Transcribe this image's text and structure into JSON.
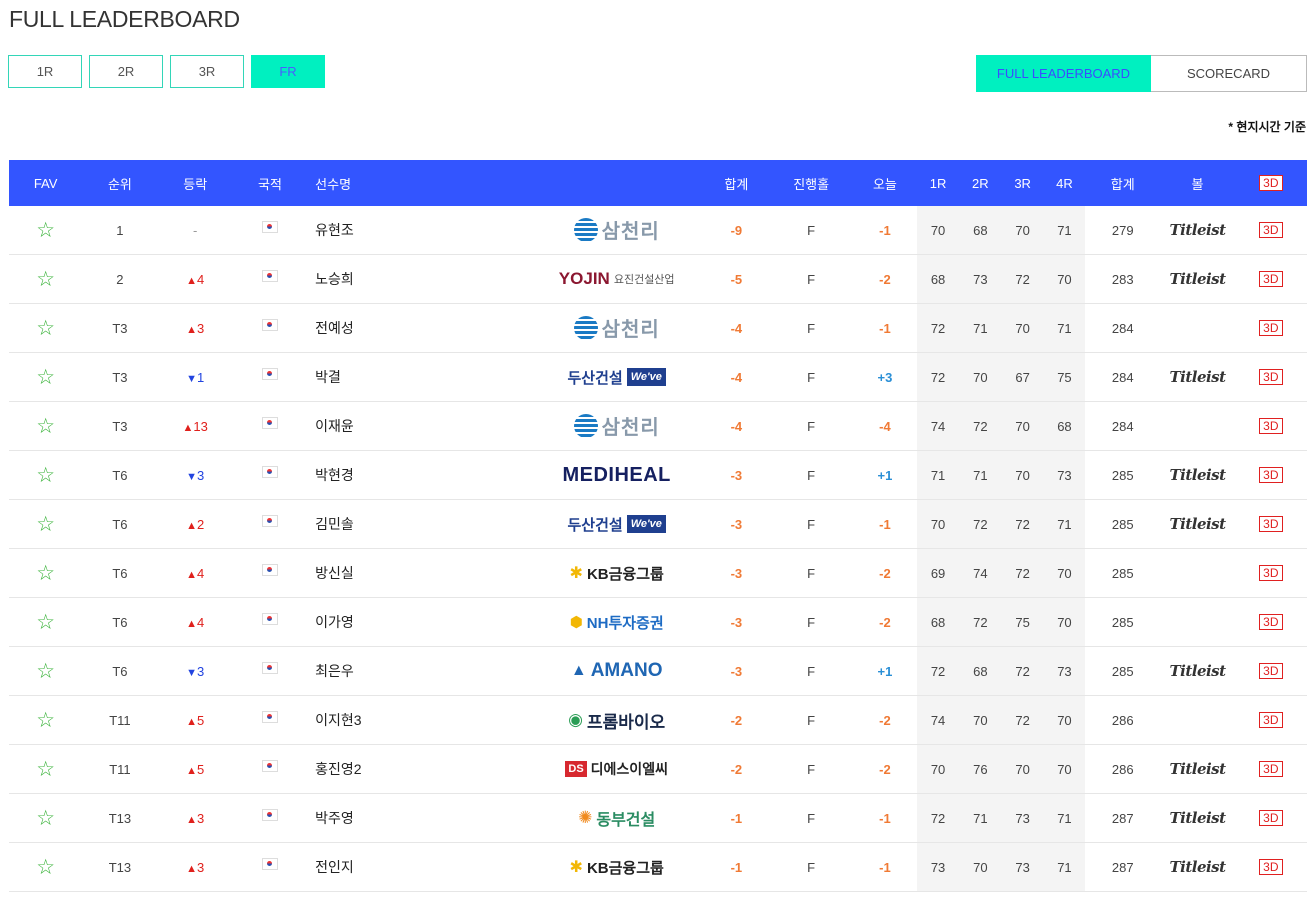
{
  "page": {
    "title": "FULL LEADERBOARD",
    "time_note": "* 현지시간 기준"
  },
  "round_tabs": [
    {
      "label": "1R",
      "active": false
    },
    {
      "label": "2R",
      "active": false
    },
    {
      "label": "3R",
      "active": false
    },
    {
      "label": "FR",
      "active": true
    }
  ],
  "view_tabs": {
    "leaderboard": "FULL LEADERBOARD",
    "scorecard": "SCORECARD"
  },
  "columns": {
    "fav": "FAV",
    "rank": "순위",
    "change": "등락",
    "nation": "국적",
    "name": "선수명",
    "total": "합계",
    "hole": "진행홀",
    "today": "오늘",
    "r1": "1R",
    "r2": "2R",
    "r3": "3R",
    "r4": "4R",
    "strokes": "합계",
    "ball": "볼",
    "view3d": "3D"
  },
  "icons": {
    "fav": "star-outline-icon",
    "nation": "korea-flag-icon",
    "up": "triangle-up-icon",
    "down": "triangle-down-icon"
  },
  "colors": {
    "header_bg": "#3355ff",
    "accent": "#00f0c0",
    "up": "#e0201c",
    "down": "#2244e0",
    "under_par": "#f07a35",
    "over_par": "#2a8fd6"
  },
  "players": [
    {
      "rank": "1",
      "dir": "flat",
      "move": "-",
      "name": "유현조",
      "sponsor": "samchully",
      "sponsor_text": "삼천리",
      "total": "-9",
      "hole": "F",
      "today": "-1",
      "r1": "70",
      "r2": "68",
      "r3": "70",
      "r4": "71",
      "strokes": "279",
      "ball": "Titleist",
      "view3d": "3D"
    },
    {
      "rank": "2",
      "dir": "up",
      "move": "4",
      "name": "노승희",
      "sponsor": "yojin",
      "sponsor_text": "YOJIN",
      "sponsor_sub": "요진건설산업",
      "total": "-5",
      "hole": "F",
      "today": "-2",
      "r1": "68",
      "r2": "73",
      "r3": "72",
      "r4": "70",
      "strokes": "283",
      "ball": "Titleist",
      "view3d": "3D"
    },
    {
      "rank": "T3",
      "dir": "up",
      "move": "3",
      "name": "전예성",
      "sponsor": "samchully",
      "sponsor_text": "삼천리",
      "total": "-4",
      "hole": "F",
      "today": "-1",
      "r1": "72",
      "r2": "71",
      "r3": "70",
      "r4": "71",
      "strokes": "284",
      "ball": "",
      "view3d": "3D"
    },
    {
      "rank": "T3",
      "dir": "down",
      "move": "1",
      "name": "박결",
      "sponsor": "doosan",
      "sponsor_text": "두산건설",
      "sponsor_sub": "We've",
      "total": "-4",
      "hole": "F",
      "today": "+3",
      "r1": "72",
      "r2": "70",
      "r3": "67",
      "r4": "75",
      "strokes": "284",
      "ball": "Titleist",
      "view3d": "3D"
    },
    {
      "rank": "T3",
      "dir": "up",
      "move": "13",
      "name": "이재윤",
      "sponsor": "samchully",
      "sponsor_text": "삼천리",
      "total": "-4",
      "hole": "F",
      "today": "-4",
      "r1": "74",
      "r2": "72",
      "r3": "70",
      "r4": "68",
      "strokes": "284",
      "ball": "",
      "view3d": "3D"
    },
    {
      "rank": "T6",
      "dir": "down",
      "move": "3",
      "name": "박현경",
      "sponsor": "mediheal",
      "sponsor_text": "MEDIHEAL",
      "total": "-3",
      "hole": "F",
      "today": "+1",
      "r1": "71",
      "r2": "71",
      "r3": "70",
      "r4": "73",
      "strokes": "285",
      "ball": "Titleist",
      "view3d": "3D"
    },
    {
      "rank": "T6",
      "dir": "up",
      "move": "2",
      "name": "김민솔",
      "sponsor": "doosan",
      "sponsor_text": "두산건설",
      "sponsor_sub": "We've",
      "total": "-3",
      "hole": "F",
      "today": "-1",
      "r1": "70",
      "r2": "72",
      "r3": "72",
      "r4": "71",
      "strokes": "285",
      "ball": "Titleist",
      "view3d": "3D"
    },
    {
      "rank": "T6",
      "dir": "up",
      "move": "4",
      "name": "방신실",
      "sponsor": "kb",
      "sponsor_text": "KB금융그룹",
      "total": "-3",
      "hole": "F",
      "today": "-2",
      "r1": "69",
      "r2": "74",
      "r3": "72",
      "r4": "70",
      "strokes": "285",
      "ball": "",
      "view3d": "3D"
    },
    {
      "rank": "T6",
      "dir": "up",
      "move": "4",
      "name": "이가영",
      "sponsor": "nh",
      "sponsor_text": "NH투자증권",
      "total": "-3",
      "hole": "F",
      "today": "-2",
      "r1": "68",
      "r2": "72",
      "r3": "75",
      "r4": "70",
      "strokes": "285",
      "ball": "",
      "view3d": "3D"
    },
    {
      "rank": "T6",
      "dir": "down",
      "move": "3",
      "name": "최은우",
      "sponsor": "amano",
      "sponsor_text": "AMANO",
      "total": "-3",
      "hole": "F",
      "today": "+1",
      "r1": "72",
      "r2": "68",
      "r3": "72",
      "r4": "73",
      "strokes": "285",
      "ball": "Titleist",
      "view3d": "3D"
    },
    {
      "rank": "T11",
      "dir": "up",
      "move": "5",
      "name": "이지현3",
      "sponsor": "prom",
      "sponsor_text": "프롬바이오",
      "total": "-2",
      "hole": "F",
      "today": "-2",
      "r1": "74",
      "r2": "70",
      "r3": "72",
      "r4": "70",
      "strokes": "286",
      "ball": "",
      "view3d": "3D"
    },
    {
      "rank": "T11",
      "dir": "up",
      "move": "5",
      "name": "홍진영2",
      "sponsor": "ds",
      "sponsor_text": "디에스이엘씨",
      "sponsor_sub": "DS",
      "total": "-2",
      "hole": "F",
      "today": "-2",
      "r1": "70",
      "r2": "76",
      "r3": "70",
      "r4": "70",
      "strokes": "286",
      "ball": "Titleist",
      "view3d": "3D"
    },
    {
      "rank": "T13",
      "dir": "up",
      "move": "3",
      "name": "박주영",
      "sponsor": "dongbu",
      "sponsor_text": "동부건설",
      "total": "-1",
      "hole": "F",
      "today": "-1",
      "r1": "72",
      "r2": "71",
      "r3": "73",
      "r4": "71",
      "strokes": "287",
      "ball": "Titleist",
      "view3d": "3D"
    },
    {
      "rank": "T13",
      "dir": "up",
      "move": "3",
      "name": "전인지",
      "sponsor": "kb",
      "sponsor_text": "KB금융그룹",
      "total": "-1",
      "hole": "F",
      "today": "-1",
      "r1": "73",
      "r2": "70",
      "r3": "73",
      "r4": "71",
      "strokes": "287",
      "ball": "Titleist",
      "view3d": "3D"
    }
  ]
}
